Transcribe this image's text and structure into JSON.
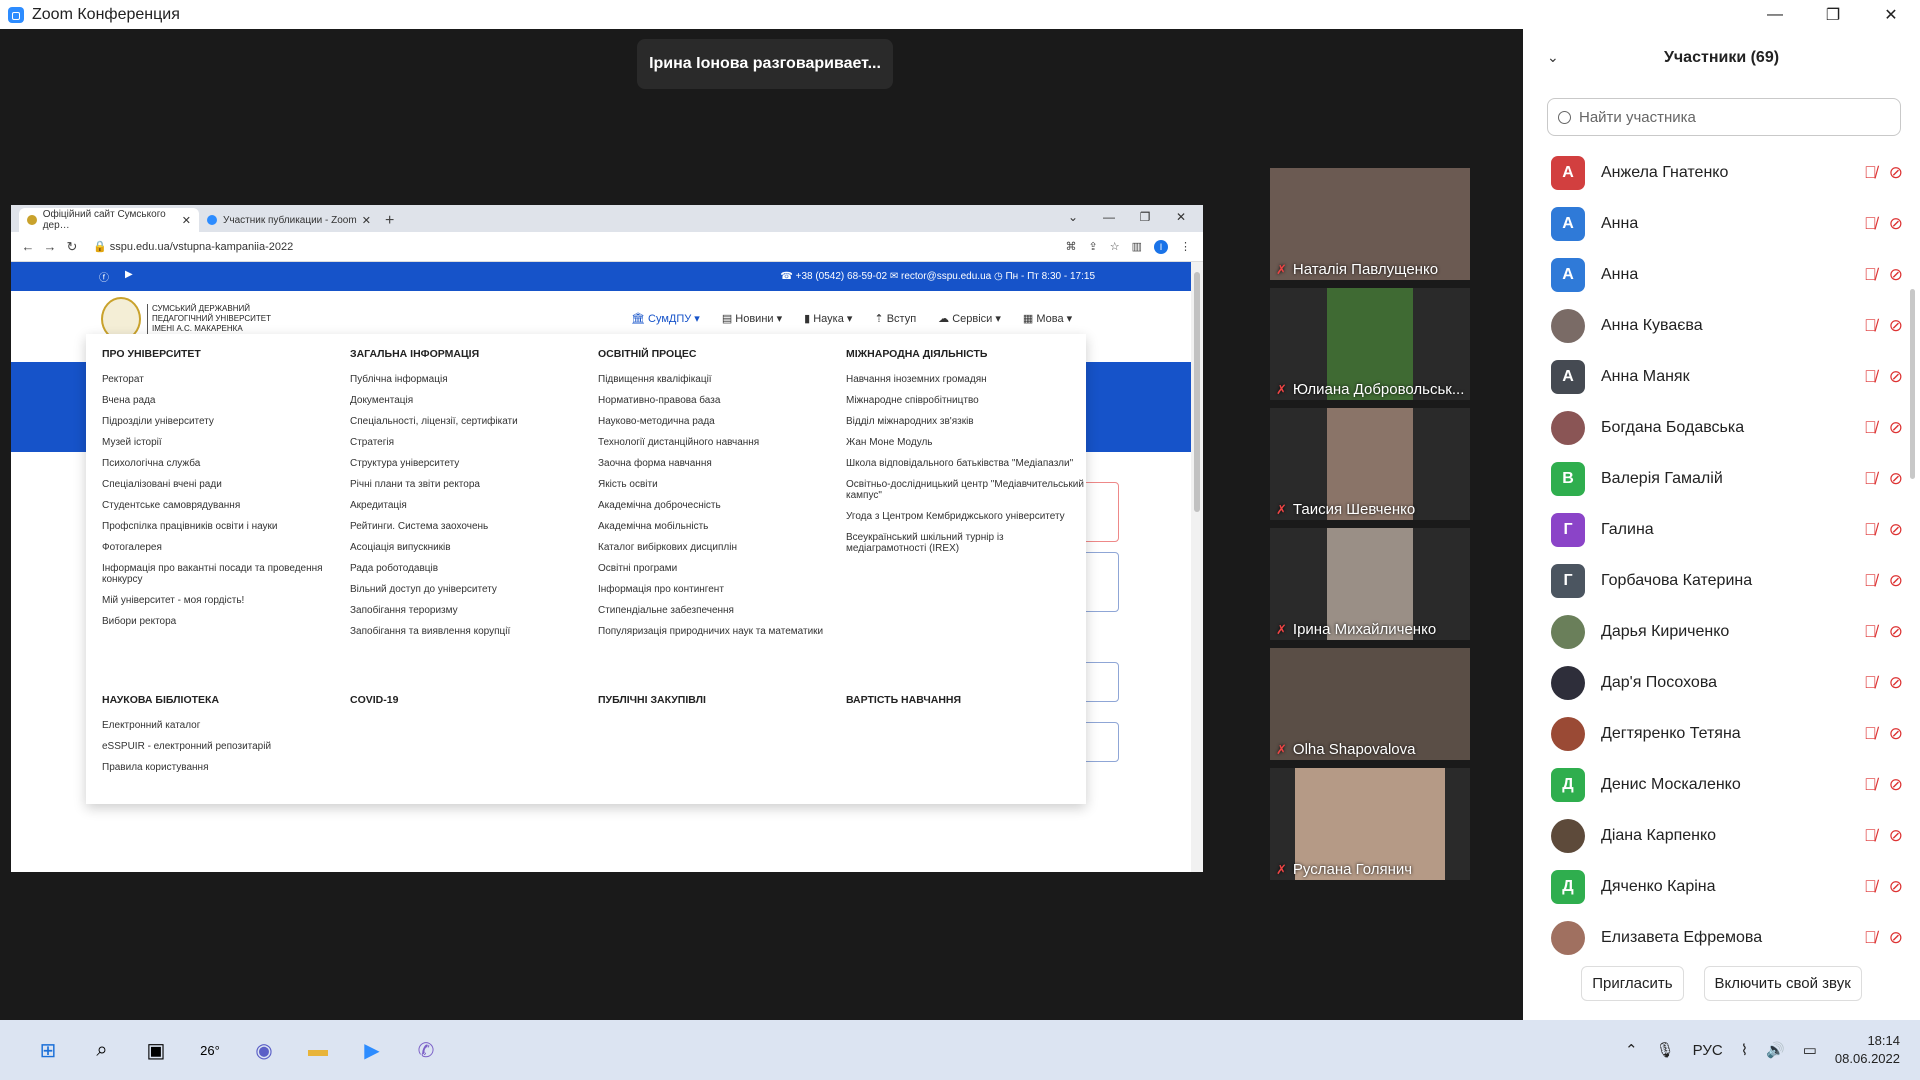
{
  "window": {
    "title": "Zoom Конференция"
  },
  "speaking": "Ірина Іонова разговаривает...",
  "browser": {
    "tabs": [
      {
        "label": "Офіційний сайт Сумського дер…",
        "color": "#c9a22c"
      },
      {
        "label": "Участник публикации - Zoom",
        "color": "#2d8cff"
      }
    ],
    "url": "sspu.edu.ua/vstupna-kampaniia-2022",
    "profile": "I",
    "contacts": "☎ +38 (0542) 68-59-02   ✉ rector@sspu.edu.ua   ◷ Пн - Пт 8:30 - 17:15",
    "logo_text": "СУМСЬКИЙ ДЕРЖАВНИЙ ПЕДАГОГІЧНИЙ УНІВЕРСИТЕТ ІМЕНІ А.С. МАКАРЕНКА",
    "menu": [
      "🏛 СумДПУ ▾",
      "▤ Новини ▾",
      "▮ Наука ▾",
      "⇡ Вступ",
      "☁ Сервіси ▾",
      "▦ Мова ▾"
    ],
    "columns": [
      {
        "title": "ПРО УНІВЕРСИТЕТ",
        "items": [
          "Ректорат",
          "Вчена рада",
          "Підрозділи університету",
          "Музей історії",
          "Психологічна служба",
          "Спеціалізовані вчені ради",
          "Студентське самоврядування",
          "Профспілка працівників освіти і науки",
          "Фотогалерея",
          "Інформація про вакантні посади та проведення конкурсу",
          "Мій університет - моя гордість!",
          "Вибори ректора"
        ]
      },
      {
        "title": "ЗАГАЛЬНА ІНФОРМАЦІЯ",
        "items": [
          "Публічна інформація",
          "Документація",
          "Спеціальності, ліцензії, сертифікати",
          "Стратегія",
          "Структура університету",
          "Річні плани та звіти ректора",
          "Акредитація",
          "Рейтинги. Система заохочень",
          "Асоціація випускників",
          "Рада роботодавців",
          "Вільний доступ до університету",
          "Запобігання тероризму",
          "Запобігання та виявлення корупції"
        ]
      },
      {
        "title": "ОСВІТНІЙ ПРОЦЕС",
        "items": [
          "Підвищення кваліфікації",
          "Нормативно-правова база",
          "Науково-методична рада",
          "Технології дистанційного навчання",
          "Заочна форма навчання",
          "Якість освіти",
          "Академічна доброчесність",
          "Академічна мобільність",
          "Каталог вибіркових дисциплін",
          "Освітні програми",
          "Інформація про контингент",
          "Стипендіальне забезпечення",
          "Популяризація природничих наук та математики"
        ]
      },
      {
        "title": "МІЖНАРОДНА ДІЯЛЬНІСТЬ",
        "items": [
          "Навчання іноземних громадян",
          "Міжнародне співробітництво",
          "Відділ міжнародних зв'язків",
          "Жан Моне Модуль",
          "Школа відповідального батьківства \"Медіапазли\"",
          "Освітньо-дослідницький центр \"Медіавчительський кампус\"",
          "Угода з Центром Кембриджського університету",
          "Всеукраїнський шкільний турнір із медіаграмотності (IREX)"
        ]
      },
      {
        "title": "НАУКОВА БІБЛІОТЕКА",
        "items": [
          "Електронний каталог",
          "eSSPUIR - електронний репозитарій",
          "Правила користування"
        ]
      },
      {
        "title": "COVID-19",
        "items": []
      },
      {
        "title": "ПУБЛІЧНІ ЗАКУПІВЛІ",
        "items": []
      },
      {
        "title": "ВАРТІСТЬ НАВЧАННЯ",
        "items": []
      }
    ]
  },
  "tiles": [
    {
      "name": "Наталія Павлущенко",
      "bg": "#6b5a52"
    },
    {
      "name": "Юлиана Добровольськ...",
      "bg": "#3f6a33"
    },
    {
      "name": "Таисия Шевченко",
      "bg": "#8a7468"
    },
    {
      "name": "Ірина Михайличенко",
      "bg": "#9a8f86"
    },
    {
      "name": "Olha Shapovalova",
      "bg": "#5a4e46"
    },
    {
      "name": "Руслана Голянич",
      "bg": "#b59a86"
    }
  ],
  "panel": {
    "title": "Участники (69)",
    "search_placeholder": "Найти участника",
    "participants": [
      {
        "initial": "А",
        "name": "Анжела Гнатенко",
        "color": "#d23f3f"
      },
      {
        "initial": "А",
        "name": "Анна",
        "color": "#2f7ad8"
      },
      {
        "initial": "А",
        "name": "Анна",
        "color": "#2f7ad8"
      },
      {
        "initial": "",
        "name": "Анна Куваєва",
        "color": "#7a6b66"
      },
      {
        "initial": "А",
        "name": "Анна Маняк",
        "color": "#454a52"
      },
      {
        "initial": "",
        "name": "Богдана Бодавська",
        "color": "#8a5555"
      },
      {
        "initial": "В",
        "name": "Валерія Гамалій",
        "color": "#2fae4e"
      },
      {
        "initial": "Г",
        "name": "Галина",
        "color": "#8b44c8"
      },
      {
        "initial": "Г",
        "name": "Горбачова Катерина",
        "color": "#4b5560"
      },
      {
        "initial": "",
        "name": "Дарья Кириченко",
        "color": "#6a7f5a"
      },
      {
        "initial": "",
        "name": "Дар'я Посохова",
        "color": "#2e2e3a"
      },
      {
        "initial": "",
        "name": "Дегтяренко Тетяна",
        "color": "#9a4a35"
      },
      {
        "initial": "Д",
        "name": "Денис Москаленко",
        "color": "#2fae4e"
      },
      {
        "initial": "",
        "name": "Діана Карпенко",
        "color": "#5d4a3a"
      },
      {
        "initial": "Д",
        "name": "Дяченко Каріна",
        "color": "#2fae4e"
      },
      {
        "initial": "",
        "name": "Елизавета Ефремова",
        "color": "#a07060"
      }
    ],
    "invite": "Пригласить",
    "unmute": "Включить свой звук"
  },
  "taskbar": {
    "weather": "26°",
    "lang": "РУС",
    "time": "18:14",
    "date": "08.06.2022"
  }
}
